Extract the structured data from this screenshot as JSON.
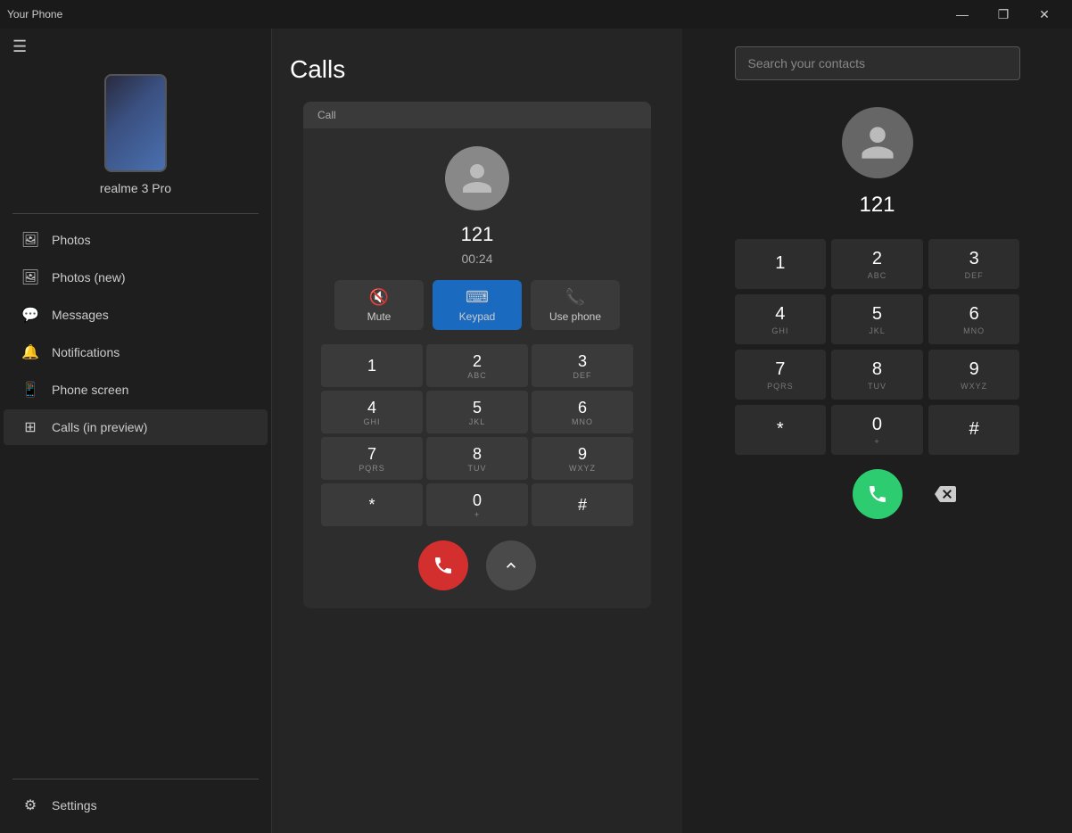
{
  "titlebar": {
    "app_name": "Your Phone",
    "minimize_label": "—",
    "maximize_label": "❐",
    "close_label": "✕"
  },
  "sidebar": {
    "hamburger": "☰",
    "device_name": "realme 3 Pro",
    "nav_items": [
      {
        "id": "photos",
        "label": "Photos",
        "icon": "🖼"
      },
      {
        "id": "photos-new",
        "label": "Photos (new)",
        "icon": "🖼"
      },
      {
        "id": "messages",
        "label": "Messages",
        "icon": "💬"
      },
      {
        "id": "notifications",
        "label": "Notifications",
        "icon": "🔔"
      },
      {
        "id": "phone-screen",
        "label": "Phone screen",
        "icon": "📱"
      },
      {
        "id": "calls",
        "label": "Calls (in preview)",
        "icon": "⊞",
        "active": true
      }
    ],
    "settings_label": "Settings",
    "settings_icon": "⚙"
  },
  "calls": {
    "title": "Calls",
    "call_label": "Call",
    "caller_number": "121",
    "call_duration": "00:24",
    "mute_label": "Mute",
    "keypad_label": "Keypad",
    "use_phone_label": "Use phone",
    "dialpad": [
      {
        "num": "1",
        "letters": ""
      },
      {
        "num": "2",
        "letters": "ABC"
      },
      {
        "num": "3",
        "letters": "DEF"
      },
      {
        "num": "4",
        "letters": "GHI"
      },
      {
        "num": "5",
        "letters": "JKL"
      },
      {
        "num": "6",
        "letters": "MNO"
      },
      {
        "num": "7",
        "letters": "PQRS"
      },
      {
        "num": "8",
        "letters": "TUV"
      },
      {
        "num": "9",
        "letters": "WXYZ"
      },
      {
        "num": "*",
        "letters": ""
      },
      {
        "num": "0",
        "letters": "+"
      },
      {
        "num": "#",
        "letters": ""
      }
    ]
  },
  "dialer": {
    "search_placeholder": "Search your contacts",
    "display_number": "121",
    "dialpad": [
      {
        "num": "1",
        "letters": ""
      },
      {
        "num": "2",
        "letters": "ABC"
      },
      {
        "num": "3",
        "letters": "DEF"
      },
      {
        "num": "4",
        "letters": "GHI"
      },
      {
        "num": "5",
        "letters": "JKL"
      },
      {
        "num": "6",
        "letters": "MNO"
      },
      {
        "num": "7",
        "letters": "PQRS"
      },
      {
        "num": "8",
        "letters": "TUV"
      },
      {
        "num": "9",
        "letters": "WXYZ"
      },
      {
        "num": "*",
        "letters": ""
      },
      {
        "num": "0",
        "letters": "+"
      },
      {
        "num": "#",
        "letters": ""
      }
    ]
  }
}
